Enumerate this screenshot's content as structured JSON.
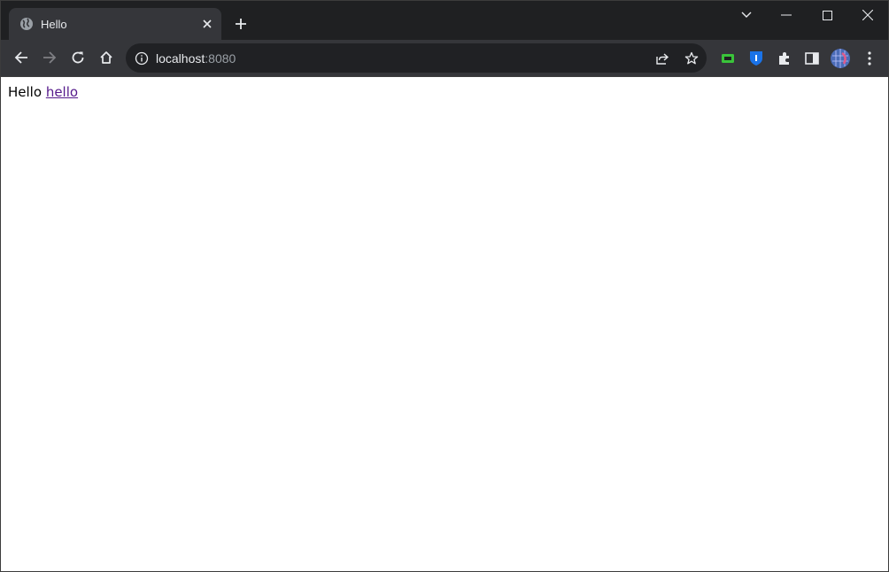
{
  "browser": {
    "tab": {
      "title": "Hello",
      "favicon": "globe-icon"
    },
    "address": {
      "host": "localhost",
      "port": ":8080"
    },
    "colors": {
      "frame": "#1f2022",
      "toolbar": "#35363a",
      "omnibox": "#202124",
      "link_visited": "#551a8b"
    }
  },
  "page": {
    "text": "Hello",
    "link": "hello"
  }
}
